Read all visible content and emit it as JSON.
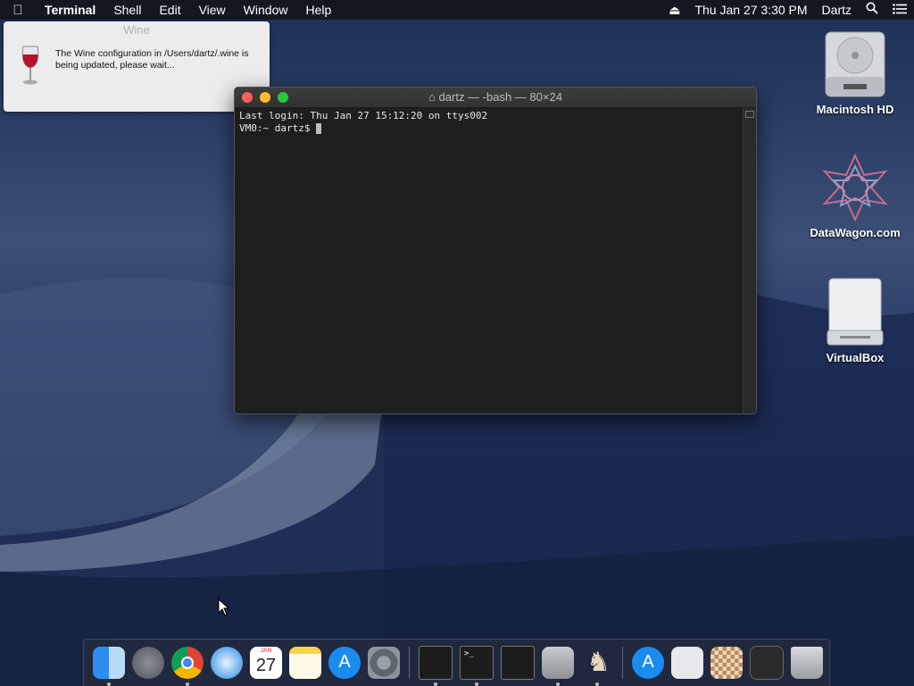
{
  "menubar": {
    "app_name": "Terminal",
    "items": [
      "Shell",
      "Edit",
      "View",
      "Window",
      "Help"
    ],
    "datetime": "Thu Jan 27  3:30 PM",
    "user": "Dartz"
  },
  "wine_notice": {
    "title": "Wine",
    "message": "The Wine configuration in /Users/dartz/.wine is being updated, please wait..."
  },
  "terminal": {
    "title": "dartz — -bash — 80×24",
    "lines": [
      "Last login: Thu Jan 27 15:12:20 on ttys002",
      "VM0:~ dartz$ "
    ]
  },
  "desktop_icons": [
    "Macintosh HD",
    "DataWagon.com",
    "VirtualBox"
  ],
  "dock": {
    "calendar_month": "JAN",
    "calendar_day": "27"
  },
  "colors": {
    "close": "#ff5f57",
    "minimize": "#febc2e",
    "zoom": "#28c840"
  }
}
